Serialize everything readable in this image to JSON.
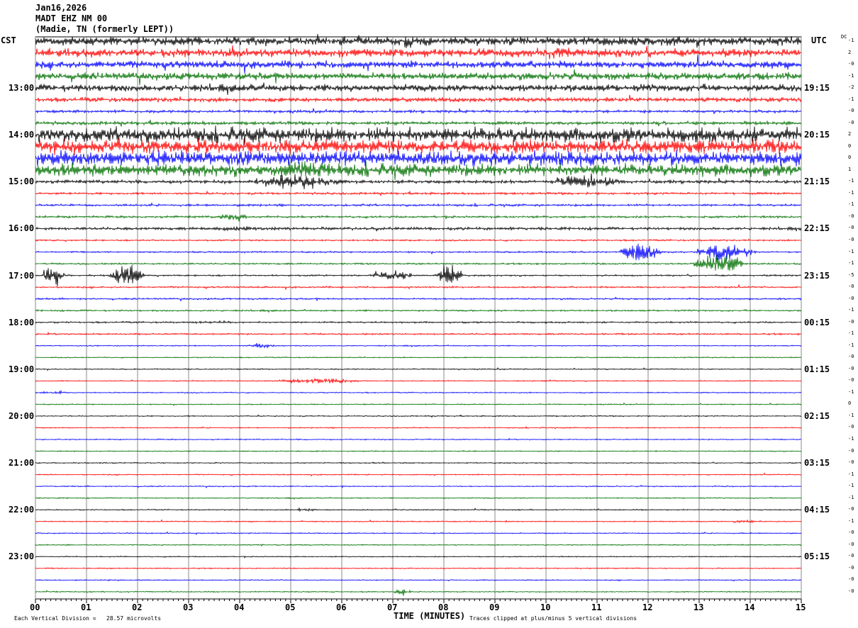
{
  "header": {
    "date": "Jan16,2026",
    "station": "MADT EHZ NM 00",
    "location": "(Madie, TN (formerly LEPT))"
  },
  "chart_data": {
    "type": "line",
    "subtype": "helicorder",
    "left_timezone": "CST",
    "right_timezone": "UTC",
    "dc_label": "DC",
    "xlabel": "TIME (MINUTES)",
    "x_ticks": [
      "00",
      "01",
      "02",
      "03",
      "04",
      "05",
      "06",
      "07",
      "08",
      "09",
      "10",
      "11",
      "12",
      "13",
      "14",
      "15"
    ],
    "xlim": [
      0,
      15
    ],
    "grid": true,
    "trace_colors": [
      "#000000",
      "#ff0000",
      "#0000ff",
      "#007000"
    ],
    "left_hour_labels": [
      "13:00",
      "14:00",
      "15:00",
      "16:00",
      "17:00",
      "18:00",
      "19:00",
      "20:00",
      "21:00",
      "22:00",
      "23:00"
    ],
    "right_hour_labels": [
      "19:15",
      "20:15",
      "21:15",
      "22:15",
      "23:15",
      "00:15",
      "01:15",
      "02:15",
      "03:15",
      "04:15",
      "05:15"
    ],
    "dc_offsets": [
      "-1",
      "2",
      "-0",
      "-1",
      "-2",
      "-1",
      "-0",
      "-0",
      "2",
      "0",
      "0",
      "1",
      "-1",
      "-1",
      "-1",
      "-0",
      "-0",
      "-0",
      "-1",
      "-1",
      "-5",
      "-0",
      "-0",
      "-1",
      "-0",
      "-1",
      "-1",
      "-0",
      "-0",
      "-0",
      "-1",
      "0",
      "-1",
      "-0",
      "-1",
      "-0",
      "-0",
      "-1",
      "-1",
      "-1",
      "-0",
      "-1",
      "-0",
      "-0",
      "-0",
      "-0",
      "-0",
      "-0"
    ],
    "noise_level_divisions": [
      1.5,
      1.5,
      1.3,
      1.3,
      1.3,
      0.8,
      0.5,
      0.6,
      2.6,
      2.6,
      2.6,
      2.2,
      0.6,
      0.4,
      0.4,
      0.4,
      0.5,
      0.3,
      0.3,
      0.3,
      0.3,
      0.3,
      0.3,
      0.3,
      0.3,
      0.3,
      0.2,
      0.2,
      0.2,
      0.2,
      0.2,
      0.2,
      0.2,
      0.2,
      0.2,
      0.2,
      0.2,
      0.2,
      0.2,
      0.2,
      0.2,
      0.2,
      0.2,
      0.2,
      0.2,
      0.2,
      0.2,
      0.2
    ],
    "events": [
      {
        "trace": 0,
        "start": 7.0,
        "end": 7.5,
        "amp": 3
      },
      {
        "trace": 0,
        "start": 14.0,
        "end": 15.0,
        "amp": 2.5
      },
      {
        "trace": 1,
        "start": 9.8,
        "end": 10.8,
        "amp": 3
      },
      {
        "trace": 11,
        "start": 4.6,
        "end": 6.0,
        "amp": 5
      },
      {
        "trace": 12,
        "start": 4.0,
        "end": 6.2,
        "amp": 3
      },
      {
        "trace": 12,
        "start": 10.0,
        "end": 11.6,
        "amp": 3
      },
      {
        "trace": 15,
        "start": 3.5,
        "end": 4.2,
        "amp": 2
      },
      {
        "trace": 16,
        "start": 3.2,
        "end": 4.8,
        "amp": 1
      },
      {
        "trace": 18,
        "start": 11.4,
        "end": 12.3,
        "amp": 5
      },
      {
        "trace": 18,
        "start": 12.8,
        "end": 14.2,
        "amp": 4
      },
      {
        "trace": 19,
        "start": 12.8,
        "end": 14.0,
        "amp": 4
      },
      {
        "trace": 20,
        "start": 0.1,
        "end": 0.6,
        "amp": 5
      },
      {
        "trace": 20,
        "start": 1.4,
        "end": 2.2,
        "amp": 4
      },
      {
        "trace": 20,
        "start": 6.5,
        "end": 7.5,
        "amp": 2
      },
      {
        "trace": 20,
        "start": 7.8,
        "end": 8.4,
        "amp": 5
      },
      {
        "trace": 24,
        "start": 3.0,
        "end": 4.0,
        "amp": 0.8
      },
      {
        "trace": 26,
        "start": 4.0,
        "end": 4.8,
        "amp": 1
      },
      {
        "trace": 29,
        "start": 4.5,
        "end": 6.6,
        "amp": 1
      },
      {
        "trace": 30,
        "start": 0.0,
        "end": 0.7,
        "amp": 0.8
      },
      {
        "trace": 40,
        "start": 5.0,
        "end": 5.6,
        "amp": 0.8
      },
      {
        "trace": 41,
        "start": 13.6,
        "end": 14.2,
        "amp": 0.8
      },
      {
        "trace": 47,
        "start": 7.0,
        "end": 7.4,
        "amp": 1.5
      }
    ]
  },
  "footer": {
    "scale_note": "Each Vertical Division =   28.57 microvolts",
    "clip_note": "Traces clipped at plus/minus 5 vertical divisions"
  }
}
